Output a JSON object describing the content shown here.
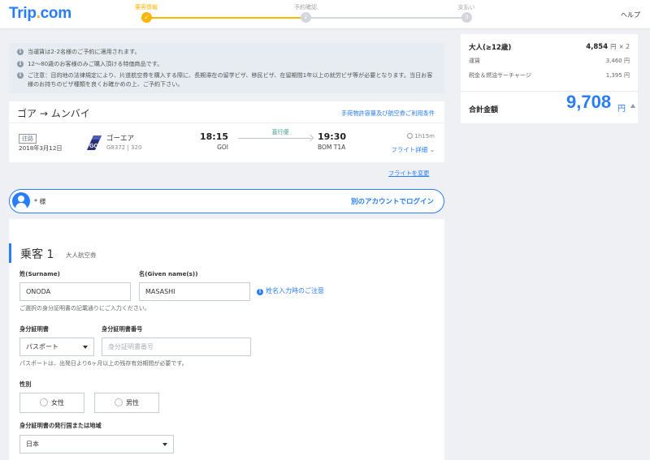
{
  "header": {
    "logo_main": "Trip",
    "logo_dot": ".",
    "logo_tld": "com",
    "help": "ヘルプ",
    "steps": [
      {
        "label": "乗客情報",
        "marker": "✓"
      },
      {
        "label": "予約確認",
        "marker": "2"
      },
      {
        "label": "支払い",
        "marker": "3"
      }
    ]
  },
  "notices": [
    "当運賃は2-2名様のご予約に適用されます。",
    "12～80歳のお客様のみご購入頂ける特価商品です。",
    "ご注意：目的地の法律規定により、片道航空券を購入する際に、長期滞在の留学ビザ、移民ビザ、在留期間1年以上の就労ビザ等が必要となります。当日お客様のお持ちのビザ種類を良くお確かめの上、ご予約下さい。"
  ],
  "flight": {
    "route_from": "ゴア",
    "route_arrow": "→",
    "route_to": "ムンバイ",
    "baggage_link": "手荷物許容量及び航空券ご利用条件",
    "trip_tag": "往路",
    "date": "2018年3月12日",
    "airline": "ゴーエア",
    "flight_no": "G8372 | 320",
    "dep_time": "18:15",
    "dep_airport": "GOI",
    "direct": "直行便",
    "arr_time": "19:30",
    "arr_airport": "BOM T1A",
    "duration": "1h15m",
    "detail_link": "フライト詳細",
    "detail_chevron": "⌄"
  },
  "change_flight": "フライトを変更",
  "account": {
    "name": "* 様",
    "login_link": "別のアカウントでログイン"
  },
  "passenger": {
    "title": "乗客 1",
    "subtitle": "大人航空券",
    "surname_label": "姓(Surname)",
    "surname_value": "ONODA",
    "given_label": "名(Given name(s))",
    "given_value": "MASASHI",
    "name_note": "姓名入力時のご注意",
    "name_hint": "ご選択の身分証明書の記載通りにご入力ください。",
    "id_label": "身分証明書",
    "id_value": "パスポート",
    "id_no_label": "身分証明書番号",
    "id_no_placeholder": "身分証明書番号",
    "passport_hint": "パスポートは、出発日より6ヶ月以上の残存有効期間が必要です。",
    "gender_label": "性別",
    "gender_female": "女性",
    "gender_male": "男性",
    "country_label": "身分証明書の発行国または地域",
    "country_value": "日本"
  },
  "price": {
    "adult_label": "大人(≥12歳)",
    "adult_value": "4,854",
    "adult_unit": "円",
    "adult_mult": "× 2",
    "fare_label": "運賃",
    "fare_value": "3,460",
    "fare_unit": "円",
    "tax_label": "税金＆燃油サーチャージ",
    "tax_value": "1,395",
    "tax_unit": "円",
    "total_label": "合計金額",
    "total_value": "9,708",
    "total_unit": "円"
  },
  "colors": {
    "brand": "#287dfa",
    "step_active": "#ffb400",
    "background": "#eef0f3"
  }
}
